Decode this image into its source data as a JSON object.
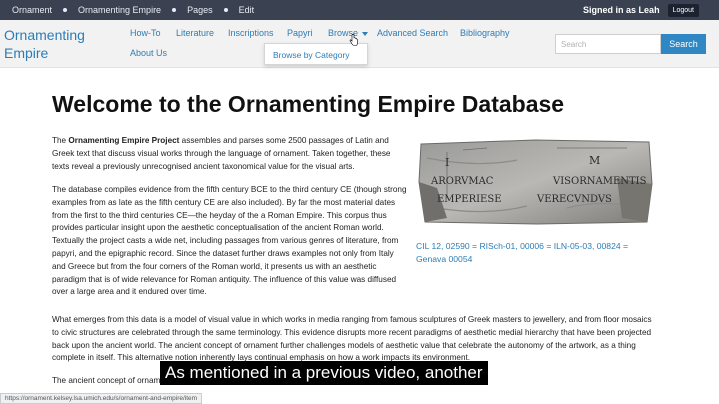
{
  "adminbar": {
    "links": [
      "Ornament",
      "Ornamenting Empire",
      "Pages",
      "Edit"
    ],
    "signed_in": "Signed in as Leah",
    "logout": "Logout"
  },
  "header": {
    "brand_line1": "Ornamenting",
    "brand_line2": "Empire",
    "nav": [
      "How-To",
      "Literature",
      "Inscriptions",
      "Papyri",
      "Browse",
      "Advanced Search",
      "Bibliography",
      "About Us"
    ],
    "dropdown_item": "Browse by Category",
    "search_placeholder": "Search",
    "search_button": "Search"
  },
  "main": {
    "title": "Welcome to the Ornamenting Empire Database",
    "p1_bold": "Ornamenting Empire Project",
    "p1_pre": "The ",
    "p1_rest": " assembles and parses some 2500 passages of Latin and Greek text that discuss visual works through the language of ornament. Taken together, these texts reveal a previously unrecognised ancient taxonomical value for the visual arts.",
    "p2": "The database compiles evidence from the fifth century BCE to the third century CE (though strong examples from as late as the fifth century CE are also included). By far the most material dates from the first to the third centuries CE—the heyday of the a Roman Empire. This corpus thus provides particular insight upon the aesthetic conceptualisation of the ancient Roman world. Textually the project casts a wide net, including passages from various genres of literature, from papyri, and the epigraphic record. Since the dataset further draws examples not only from Italy and Greece but from the four corners of the Roman world, it presents us with an aesthetic paradigm that is of wide relevance for Roman antiquity. The influence of this value was diffused over a large area and it endured over time.",
    "p3": "What emerges from this data is a model of visual value in which works in media ranging from famous sculptures of Greek masters to jewellery, and from floor mosaics to civic structures are celebrated through the same terminology. This evidence disrupts more recent paradigms of aesthetic medial hierarchy that have been projected back upon the ancient world. The ancient concept of ornament further challenges models of aesthetic value that celebrate the autonomy of the artwork, as a thing complete in itself. This alternative notion inherently lays continual emphasis on how a work impacts its environment.",
    "p4": "The ancient concept of ornament ... Roman aesthetic notions of",
    "image_caption": "CIL 12, 02590 = RISch-01, 00006 = ILN-05-03, 00824 = Genava 00054"
  },
  "statusbar": "https://ornament.kelsey.lsa.umich.edu/s/ornament-and-empire/item",
  "subtitle": "As mentioned in a previous video, another"
}
